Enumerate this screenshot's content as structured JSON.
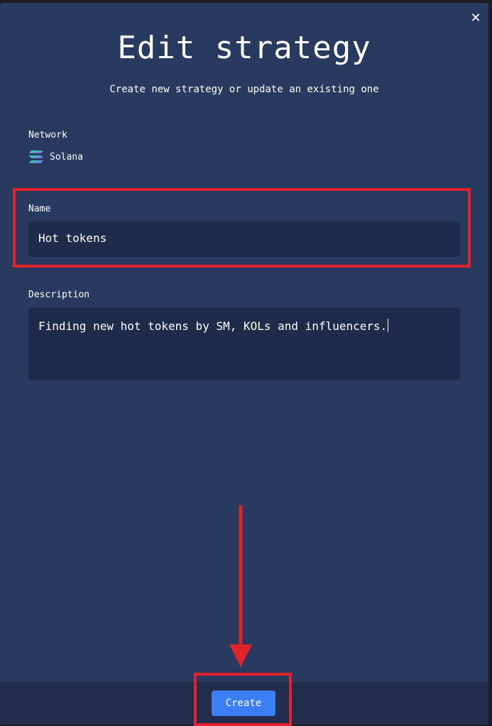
{
  "modal": {
    "title": "Edit strategy",
    "subtitle": "Create new strategy or update an existing one",
    "close_icon": "close-icon"
  },
  "network": {
    "label": "Network",
    "value": "Solana",
    "icon": "solana-logo-icon"
  },
  "name": {
    "label": "Name",
    "value": "Hot tokens"
  },
  "description": {
    "label": "Description",
    "value": "Finding new hot tokens by SM, KOLs and influencers."
  },
  "footer": {
    "create_label": "Create"
  },
  "colors": {
    "modal_bg": "#293a60",
    "field_bg": "#1f2b4b",
    "button_bg": "#3b7ef5",
    "annotation": "#e3232a"
  }
}
